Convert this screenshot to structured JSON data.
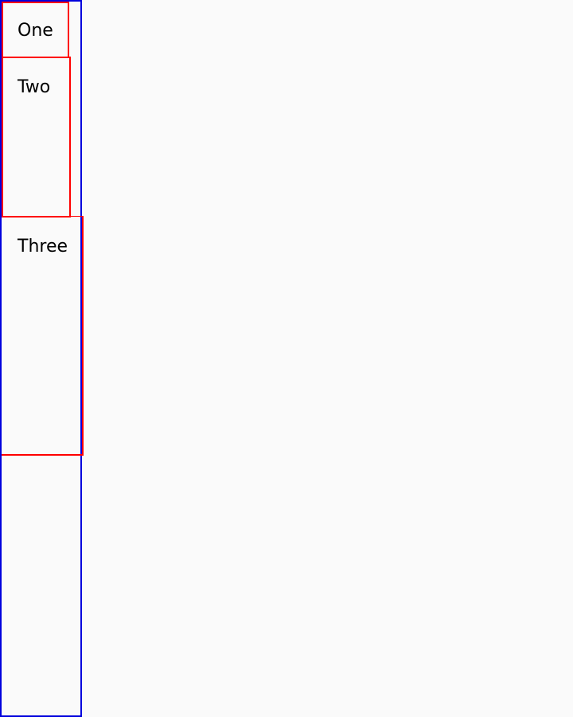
{
  "panels": {
    "one": {
      "label": "One"
    },
    "two": {
      "label": "Two"
    },
    "three": {
      "label": "Three"
    }
  },
  "colors": {
    "background": "#fafafa",
    "outer_border": "#0000dd",
    "panel_border": "#ff0000",
    "text": "#000000"
  }
}
